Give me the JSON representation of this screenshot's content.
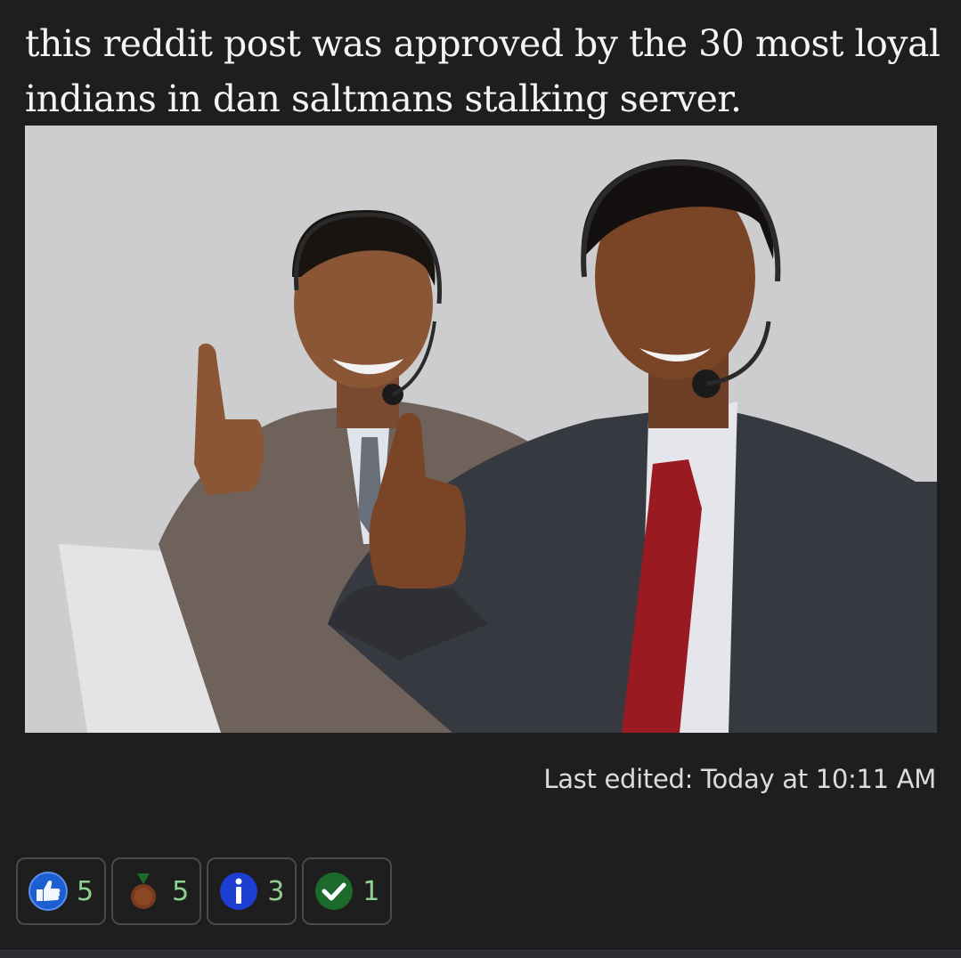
{
  "post": {
    "text": "this reddit post was approved by the 30 most loyal indians in dan saltmans stalking server.",
    "last_edited": "Last edited: Today at 10:11 AM"
  },
  "reactions": [
    {
      "icon": "thumbs-up-icon",
      "count": "5",
      "color": "#1d5fd1"
    },
    {
      "icon": "medal-icon",
      "count": "5",
      "color": "#7a3a1c"
    },
    {
      "icon": "info-icon",
      "count": "3",
      "color": "#1d3fd1"
    },
    {
      "icon": "checkmark-icon",
      "count": "1",
      "color": "#1c6b2c"
    }
  ]
}
